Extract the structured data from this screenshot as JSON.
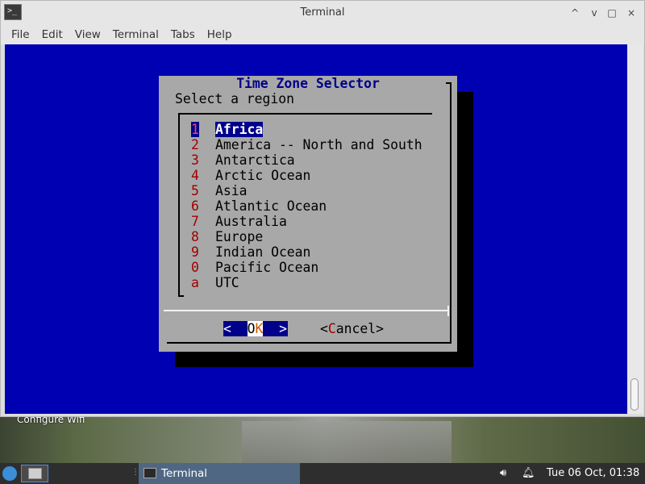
{
  "window": {
    "title": "Terminal",
    "controls": [
      "^",
      "v",
      "□",
      "×"
    ],
    "menu": [
      "File",
      "Edit",
      "View",
      "Terminal",
      "Tabs",
      "Help"
    ]
  },
  "dialog": {
    "title": "Time Zone Selector",
    "prompt": "Select a region",
    "items": [
      {
        "tag": "1",
        "label": "Africa",
        "selected": true
      },
      {
        "tag": "2",
        "label": "America -- North and South"
      },
      {
        "tag": "3",
        "label": "Antarctica"
      },
      {
        "tag": "4",
        "label": "Arctic Ocean"
      },
      {
        "tag": "5",
        "label": "Asia"
      },
      {
        "tag": "6",
        "label": "Atlantic Ocean"
      },
      {
        "tag": "7",
        "label": "Australia"
      },
      {
        "tag": "8",
        "label": "Europe"
      },
      {
        "tag": "9",
        "label": "Indian Ocean"
      },
      {
        "tag": "0",
        "label": "Pacific Ocean"
      },
      {
        "tag": "a",
        "label": "UTC"
      }
    ],
    "ok": {
      "left": "<  ",
      "pre": "O",
      "hot": "K",
      "right": "  >"
    },
    "cancel": {
      "open": "<",
      "hot": "C",
      "rest": "ancel>"
    }
  },
  "desktop": {
    "label": "Configure Wifi"
  },
  "taskbar": {
    "task_label": "Terminal",
    "clock": "Tue 06 Oct, 01:38"
  },
  "colors": {
    "terminal_bg": "#0000b3",
    "dialog_bg": "#a8a8a8",
    "accent": "#00008b",
    "hotkey": "#a00000"
  }
}
